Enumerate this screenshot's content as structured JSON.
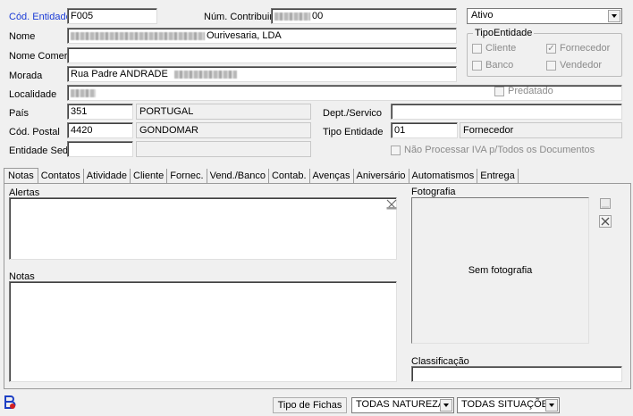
{
  "header": {
    "cod_entidade_label": "Cód. Entidade",
    "cod_entidade_value": "F005",
    "num_contribuinte_label": "Núm. Contribuinte",
    "num_contribuinte_suffix": "00",
    "estado_value": "Ativo",
    "nome_label": "Nome",
    "nome_suffix": "Ourivesaria, LDA",
    "nome_comercial_label": "Nome Comercial",
    "nome_comercial_value": "",
    "morada_label": "Morada",
    "morada_value": "Rua Padre ANDRADE",
    "localidade_label": "Localidade",
    "pais_label": "País",
    "pais_code": "351",
    "pais_name": "PORTUGAL",
    "cod_postal_label": "Cód. Postal",
    "cod_postal_code": "4420",
    "cod_postal_name": "GONDOMAR",
    "entidade_sede_label": "Entidade Sede",
    "entidade_sede_value": "",
    "dept_servico_label": "Dept./Servico",
    "dept_servico_value": "",
    "tipo_entidade_label": "Tipo Entidade",
    "tipo_entidade_code": "01",
    "tipo_entidade_name": "Fornecedor"
  },
  "tipo_entidade_group": {
    "title": "TipoEntidade",
    "options": [
      {
        "label": "Cliente",
        "checked": false
      },
      {
        "label": "Fornecedor",
        "checked": true
      },
      {
        "label": "Banco",
        "checked": false
      },
      {
        "label": "Vendedor",
        "checked": false
      }
    ]
  },
  "checks": {
    "predatado": "Predatado",
    "nao_processar_iva": "Não Processar IVA p/Todos os Documentos"
  },
  "tabs": [
    "Notas",
    "Contatos",
    "Atividade",
    "Cliente",
    "Fornec.",
    "Vend./Banco",
    "Contab.",
    "Avenças",
    "Aniversário",
    "Automatismos",
    "Entrega"
  ],
  "notas_tab": {
    "alertas_label": "Alertas",
    "alertas_value": "",
    "notas_label": "Notas",
    "notas_value": "",
    "fotografia_label": "Fotografia",
    "sem_fotografia": "Sem fotografia",
    "classificacao_label": "Classificação",
    "classificacao_value": ""
  },
  "statusbar": {
    "tipo_fichas_label": "Tipo de Fichas",
    "naturezas_value": "TODAS NATUREZAS",
    "situacoes_value": "TODAS SITUAÇÕES"
  },
  "icons": {
    "app": "app-logo-icon",
    "clear_alerts": "clear-field-icon",
    "photo_load": "load-photo-icon",
    "photo_delete": "delete-photo-icon"
  },
  "colors": {
    "accent_label": "#1a3bd6",
    "background": "#f0f0f0"
  }
}
